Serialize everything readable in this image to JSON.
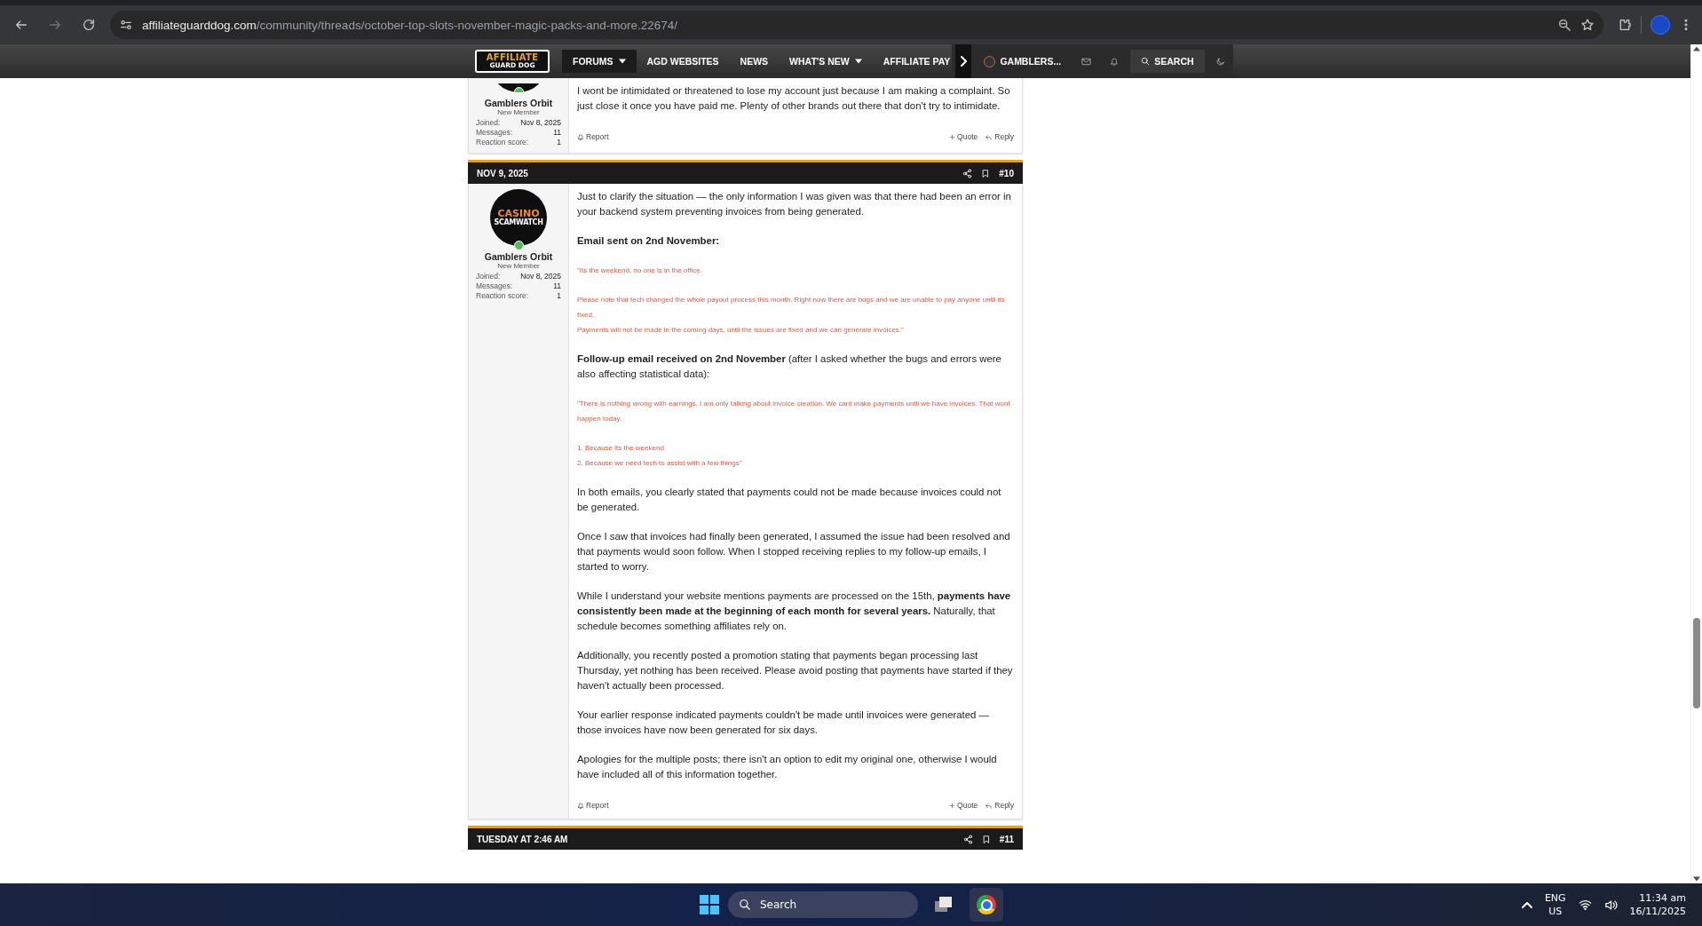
{
  "browser": {
    "url_host": "affiliateguarddog.com",
    "url_path": "/community/threads/october-top-slots-november-magic-packs-and-more.22674/"
  },
  "nav": {
    "logo": [
      "AFFILIATE",
      "GUARD DOG"
    ],
    "items": [
      {
        "label": "FORUMS",
        "selected": true,
        "dropdown": true
      },
      {
        "label": "AGD WEBSITES",
        "selected": false,
        "dropdown": false
      },
      {
        "label": "NEWS",
        "selected": false,
        "dropdown": false
      },
      {
        "label": "WHAT'S NEW",
        "selected": false,
        "dropdown": true
      },
      {
        "label": "AFFILIATE PAY",
        "selected": false,
        "dropdown": false
      }
    ],
    "user": "GAMBLERS...",
    "search": "SEARCH"
  },
  "posts": [
    {
      "author": "Gamblers Orbit",
      "role": "New Member",
      "online": true,
      "avatar_cropped": true,
      "stats": [
        {
          "label": "Joined:",
          "value": "Nov 8, 2025"
        },
        {
          "label": "Messages:",
          "value": "11"
        },
        {
          "label": "Reaction score:",
          "value": "1"
        }
      ],
      "blocks": [
        {
          "kind": "text",
          "text": "I wont be intimidated or threatened to lose my account just because I am making a complaint. So just close it once you have paid me. Plenty of other brands out there that don't try to intimidate."
        }
      ],
      "actions": {
        "report": "Report",
        "quote": "Quote",
        "reply": "Reply"
      }
    },
    {
      "date": "NOV 9, 2025",
      "number": "#10",
      "author": "Gamblers Orbit",
      "role": "New Member",
      "online": true,
      "avatar_cropped": false,
      "avatar_text": [
        "CASINO",
        "SCAMWATCH"
      ],
      "stats": [
        {
          "label": "Joined:",
          "value": "Nov 8, 2025"
        },
        {
          "label": "Messages:",
          "value": "11"
        },
        {
          "label": "Reaction score:",
          "value": "1"
        }
      ],
      "blocks": [
        {
          "kind": "text",
          "text": "Just to clarify the situation — the only information I was given was that there had been an error in your backend system preventing invoices from being generated."
        },
        {
          "kind": "heading",
          "text": "Email sent on 2nd November:"
        },
        {
          "kind": "quote",
          "lines": [
            "\"Its the weekend, no one is in the office."
          ]
        },
        {
          "kind": "quote",
          "lines": [
            "Please note that tech changed the whole payout process this month. Right now there are bugs and we are unable to pay anyone until its fixed.",
            "Payments will not be made in the coming days, until the issues are fixed and we can generate invoices.\""
          ]
        },
        {
          "kind": "text",
          "text": "**Follow-up email received on 2nd November** (after I asked whether the bugs and errors were also affecting statistical data):"
        },
        {
          "kind": "quote",
          "lines": [
            "\"There is nothing wrong with earnings. I am only talking about invoice creation. We cant make payments until we have invoices. That wont happen today."
          ]
        },
        {
          "kind": "quote",
          "lines": [
            "1. Because its the weekend",
            "2. Because we need tech to assist with a few things\""
          ]
        },
        {
          "kind": "text",
          "text": "In both emails, you clearly stated that payments could not be made because invoices could not be generated."
        },
        {
          "kind": "text",
          "text": "Once I saw that invoices had finally been generated, I assumed the issue had been resolved and that payments would soon follow. When I stopped receiving replies to my follow-up emails, I started to worry."
        },
        {
          "kind": "text",
          "text": "While I understand your website mentions payments are processed on the 15th, **payments have consistently been made at the beginning of each month for several years.** Naturally, that schedule becomes something affiliates rely on."
        },
        {
          "kind": "text",
          "text": "Additionally, you recently posted a promotion stating that payments began processing last Thursday, yet nothing has been received. Please avoid posting that payments have started if they haven't actually been processed."
        },
        {
          "kind": "text",
          "text": "Your earlier response indicated payments couldn't be made until invoices were generated — those invoices have now been generated for six days."
        },
        {
          "kind": "text",
          "text": "Apologies for the multiple posts; there isn't an option to edit my original one, otherwise I would have included all of this information together."
        }
      ],
      "actions": {
        "report": "Report",
        "quote": "Quote",
        "reply": "Reply"
      }
    },
    {
      "date": "TUESDAY AT 2:46 AM",
      "number": "#11"
    }
  ],
  "taskbar": {
    "search": "Search",
    "lang": [
      "ENG",
      "US"
    ],
    "time": "11:34 am",
    "date": "16/11/2025"
  }
}
